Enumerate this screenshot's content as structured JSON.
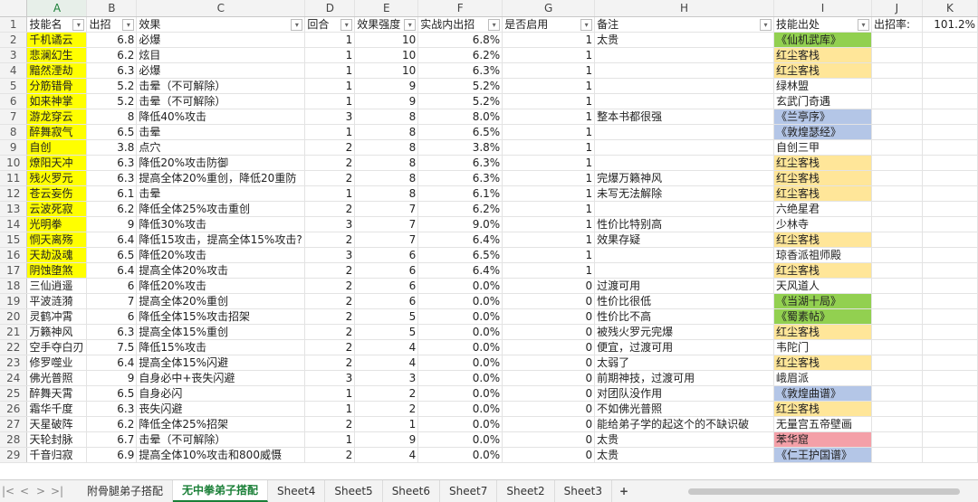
{
  "sheet": {
    "columns": [
      "A",
      "B",
      "C",
      "D",
      "E",
      "F",
      "G",
      "H",
      "I",
      "J",
      "K"
    ],
    "header_row": {
      "row_number": "1",
      "A": "技能名",
      "B": "出招",
      "C": "效果",
      "D": "回合",
      "E": "效果强度",
      "F": "实战内出招",
      "G": "是否启用",
      "H": "备注",
      "I": "技能出处",
      "J": "出招率:",
      "K": "101.2%"
    },
    "rows": [
      {
        "n": "2",
        "name": "千机谲云",
        "chu": "6.8",
        "effect": "必爆",
        "round": "1",
        "strength": "10",
        "rate": "6.8%",
        "enabled": "1",
        "note": "太贵",
        "source": "《仙机武库》",
        "hl": "yellow",
        "src_color": "green"
      },
      {
        "n": "3",
        "name": "悲澜幻生",
        "chu": "6.2",
        "effect": "炫目",
        "round": "1",
        "strength": "10",
        "rate": "6.2%",
        "enabled": "1",
        "note": "",
        "source": "红尘客栈",
        "hl": "yellow",
        "src_color": "tan"
      },
      {
        "n": "4",
        "name": "黯然湮劫",
        "chu": "6.3",
        "effect": "必爆",
        "round": "1",
        "strength": "10",
        "rate": "6.3%",
        "enabled": "1",
        "note": "",
        "source": "红尘客栈",
        "hl": "yellow",
        "src_color": "tan"
      },
      {
        "n": "5",
        "name": "分筋错骨",
        "chu": "5.2",
        "effect": "击晕（不可解除）",
        "round": "1",
        "strength": "9",
        "rate": "5.2%",
        "enabled": "1",
        "note": "",
        "source": "绿林盟",
        "hl": "yellow",
        "src_color": ""
      },
      {
        "n": "6",
        "name": "如来神掌",
        "chu": "5.2",
        "effect": "击晕（不可解除）",
        "round": "1",
        "strength": "9",
        "rate": "5.2%",
        "enabled": "1",
        "note": "",
        "source": "玄武门奇遇",
        "hl": "yellow",
        "src_color": ""
      },
      {
        "n": "7",
        "name": "游龙穿云",
        "chu": "8",
        "effect": "降低40%攻击",
        "round": "3",
        "strength": "8",
        "rate": "8.0%",
        "enabled": "1",
        "note": "整本书都很强",
        "source": "《兰亭序》",
        "hl": "yellow",
        "src_color": "blue"
      },
      {
        "n": "8",
        "name": "醉舞寂气",
        "chu": "6.5",
        "effect": "击晕",
        "round": "1",
        "strength": "8",
        "rate": "6.5%",
        "enabled": "1",
        "note": "",
        "source": "《敦煌瑟经》",
        "hl": "yellow",
        "src_color": "blue"
      },
      {
        "n": "9",
        "name": "自创",
        "chu": "3.8",
        "effect": "点穴",
        "round": "2",
        "strength": "8",
        "rate": "3.8%",
        "enabled": "1",
        "note": "",
        "source": "自创三甲",
        "hl": "yellow",
        "src_color": ""
      },
      {
        "n": "10",
        "name": "燎阳天冲",
        "chu": "6.3",
        "effect": "降低20%攻击防御",
        "round": "2",
        "strength": "8",
        "rate": "6.3%",
        "enabled": "1",
        "note": "",
        "source": "红尘客栈",
        "hl": "yellow",
        "src_color": "tan"
      },
      {
        "n": "11",
        "name": "残火罗元",
        "chu": "6.3",
        "effect": "提高全体20%重创，降低20重防",
        "round": "2",
        "strength": "8",
        "rate": "6.3%",
        "enabled": "1",
        "note": "完爆万籁神风",
        "source": "红尘客栈",
        "hl": "yellow",
        "src_color": "tan"
      },
      {
        "n": "12",
        "name": "苍云妄伤",
        "chu": "6.1",
        "effect": "击晕",
        "round": "1",
        "strength": "8",
        "rate": "6.1%",
        "enabled": "1",
        "note": "未写无法解除",
        "source": "红尘客栈",
        "hl": "yellow",
        "src_color": "tan"
      },
      {
        "n": "13",
        "name": "云波死寂",
        "chu": "6.2",
        "effect": "降低全体25%攻击重创",
        "round": "2",
        "strength": "7",
        "rate": "6.2%",
        "enabled": "1",
        "note": "",
        "source": "六绝星君",
        "hl": "yellow",
        "src_color": ""
      },
      {
        "n": "14",
        "name": "光明拳",
        "chu": "9",
        "effect": "降低30%攻击",
        "round": "3",
        "strength": "7",
        "rate": "9.0%",
        "enabled": "1",
        "note": "性价比特别高",
        "source": "少林寺",
        "hl": "yellow",
        "src_color": ""
      },
      {
        "n": "15",
        "name": "恫天离殇",
        "chu": "6.4",
        "effect": "降低15攻击，提高全体15%攻击?",
        "round": "2",
        "strength": "7",
        "rate": "6.4%",
        "enabled": "1",
        "note": "效果存疑",
        "source": "红尘客栈",
        "hl": "yellow",
        "src_color": "tan"
      },
      {
        "n": "16",
        "name": "天劫汲魂",
        "chu": "6.5",
        "effect": "降低20%攻击",
        "round": "3",
        "strength": "6",
        "rate": "6.5%",
        "enabled": "1",
        "note": "",
        "source": "琼香派祖师殿",
        "hl": "yellow",
        "src_color": ""
      },
      {
        "n": "17",
        "name": "阴蚀堕煞",
        "chu": "6.4",
        "effect": "提高全体20%攻击",
        "round": "2",
        "strength": "6",
        "rate": "6.4%",
        "enabled": "1",
        "note": "",
        "source": "红尘客栈",
        "hl": "yellow",
        "src_color": "tan"
      },
      {
        "n": "18",
        "name": "三仙逍遥",
        "chu": "6",
        "effect": "降低20%攻击",
        "round": "2",
        "strength": "6",
        "rate": "0.0%",
        "enabled": "0",
        "note": "过渡可用",
        "source": "天风道人",
        "hl": "",
        "src_color": ""
      },
      {
        "n": "19",
        "name": "平波涟漪",
        "chu": "7",
        "effect": "提高全体20%重创",
        "round": "2",
        "strength": "6",
        "rate": "0.0%",
        "enabled": "0",
        "note": "性价比很低",
        "source": "《当湖十局》",
        "hl": "",
        "src_color": "green"
      },
      {
        "n": "20",
        "name": "灵鹤冲霄",
        "chu": "6",
        "effect": "降低全体15%攻击招架",
        "round": "2",
        "strength": "5",
        "rate": "0.0%",
        "enabled": "0",
        "note": "性价比不高",
        "source": "《蜀素帖》",
        "hl": "",
        "src_color": "green"
      },
      {
        "n": "21",
        "name": "万籁神风",
        "chu": "6.3",
        "effect": "提高全体15%重创",
        "round": "2",
        "strength": "5",
        "rate": "0.0%",
        "enabled": "0",
        "note": "被残火罗元完爆",
        "source": "红尘客栈",
        "hl": "",
        "src_color": "tan"
      },
      {
        "n": "22",
        "name": "空手夺白刃",
        "chu": "7.5",
        "effect": "降低15%攻击",
        "round": "2",
        "strength": "4",
        "rate": "0.0%",
        "enabled": "0",
        "note": "便宜，过渡可用",
        "source": "韦陀门",
        "hl": "",
        "src_color": ""
      },
      {
        "n": "23",
        "name": "修罗噬业",
        "chu": "6.4",
        "effect": "提高全体15%闪避",
        "round": "2",
        "strength": "4",
        "rate": "0.0%",
        "enabled": "0",
        "note": "太弱了",
        "source": "红尘客栈",
        "hl": "",
        "src_color": "tan"
      },
      {
        "n": "24",
        "name": "佛光普照",
        "chu": "9",
        "effect": "自身必中+丧失闪避",
        "round": "3",
        "strength": "3",
        "rate": "0.0%",
        "enabled": "0",
        "note": "前期神技，过渡可用",
        "source": "峨眉派",
        "hl": "",
        "src_color": ""
      },
      {
        "n": "25",
        "name": "醉舞天霄",
        "chu": "6.5",
        "effect": "自身必闪",
        "round": "1",
        "strength": "2",
        "rate": "0.0%",
        "enabled": "0",
        "note": "对团队没作用",
        "source": "《敦煌曲谱》",
        "hl": "",
        "src_color": "blue"
      },
      {
        "n": "26",
        "name": "霜华千度",
        "chu": "6.3",
        "effect": "丧失闪避",
        "round": "1",
        "strength": "2",
        "rate": "0.0%",
        "enabled": "0",
        "note": "不如佛光普照",
        "source": "红尘客栈",
        "hl": "",
        "src_color": "tan"
      },
      {
        "n": "27",
        "name": "天星破阵",
        "chu": "6.2",
        "effect": "降低全体25%招架",
        "round": "2",
        "strength": "1",
        "rate": "0.0%",
        "enabled": "0",
        "note": "能给弟子学的起这个的不缺识破",
        "source": "无量宫五帝壁画",
        "hl": "",
        "src_color": ""
      },
      {
        "n": "28",
        "name": "天轮封脉",
        "chu": "6.7",
        "effect": "击晕（不可解除）",
        "round": "1",
        "strength": "9",
        "rate": "0.0%",
        "enabled": "0",
        "note": "太贵",
        "source": "苯华窟",
        "hl": "",
        "src_color": "pink"
      },
      {
        "n": "29",
        "name": "千音归寂",
        "chu": "6.9",
        "effect": "提高全体10%攻击和800威慑",
        "round": "2",
        "strength": "4",
        "rate": "0.0%",
        "enabled": "0",
        "note": "太贵",
        "source": "《仁王护国谱》",
        "hl": "",
        "src_color": "blue"
      }
    ]
  },
  "tabs": {
    "items": [
      "附骨腿弟子搭配",
      "无中拳弟子搭配",
      "Sheet4",
      "Sheet5",
      "Sheet6",
      "Sheet7",
      "Sheet2",
      "Sheet3"
    ],
    "active_index": 1,
    "add_label": "+"
  },
  "nav": {
    "first": "|<",
    "prev": "<",
    "next": ">",
    "last": ">|"
  },
  "colors": {
    "yellow": "#ffff00",
    "green": "#92d050",
    "tan": "#ffe699",
    "blue": "#b4c6e7",
    "pink": "#f4a0a8",
    "accent": "#1a7f37"
  }
}
